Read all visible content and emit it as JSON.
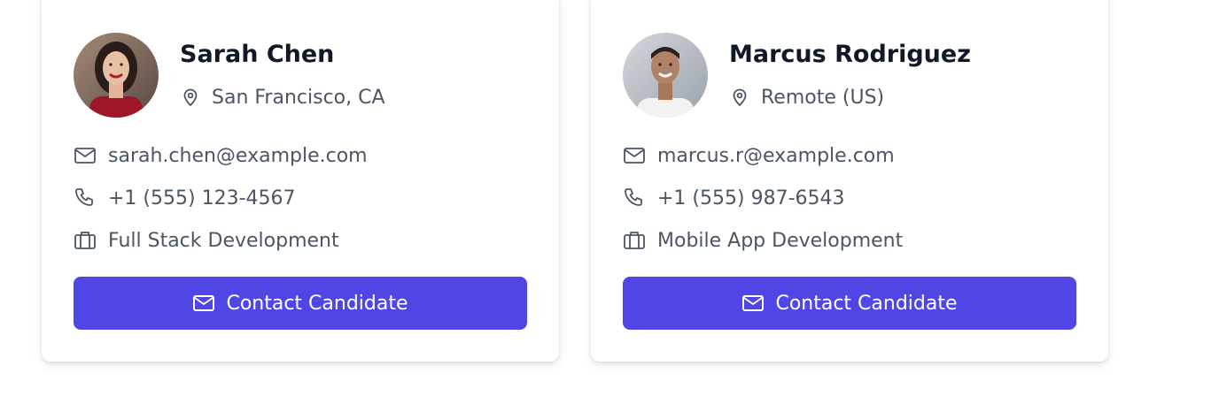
{
  "candidates": [
    {
      "name": "Sarah Chen",
      "location": "San Francisco, CA",
      "email": "sarah.chen@example.com",
      "phone": "+1 (555) 123-4567",
      "specialty": "Full Stack Development",
      "button_label": "Contact Candidate",
      "avatar_icon": "avatar-photo"
    },
    {
      "name": "Marcus Rodriguez",
      "location": "Remote (US)",
      "email": "marcus.r@example.com",
      "phone": "+1 (555) 987-6543",
      "specialty": "Mobile App Development",
      "button_label": "Contact Candidate",
      "avatar_icon": "avatar-photo"
    }
  ],
  "icons": {
    "location": "map-pin-icon",
    "email": "mail-icon",
    "phone": "phone-icon",
    "specialty": "briefcase-icon",
    "button": "mail-icon"
  },
  "colors": {
    "accent": "#4f46e5",
    "name_text": "#111827",
    "body_text": "#4b5563",
    "card_bg": "#ffffff"
  }
}
